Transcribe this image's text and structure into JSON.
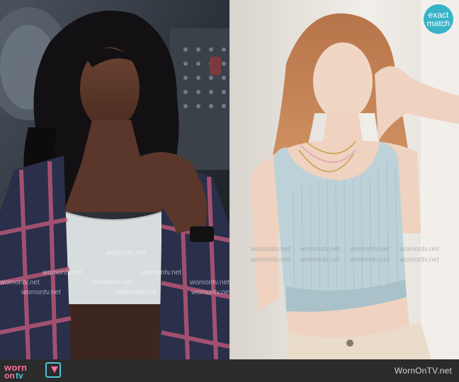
{
  "badge": {
    "line1": "exact",
    "line2": "match"
  },
  "watermark": "womontv.net",
  "footer": {
    "logo_worn": "worn",
    "logo_on": "on",
    "logo_tv": "tv",
    "site": "WornOnTV.net"
  }
}
